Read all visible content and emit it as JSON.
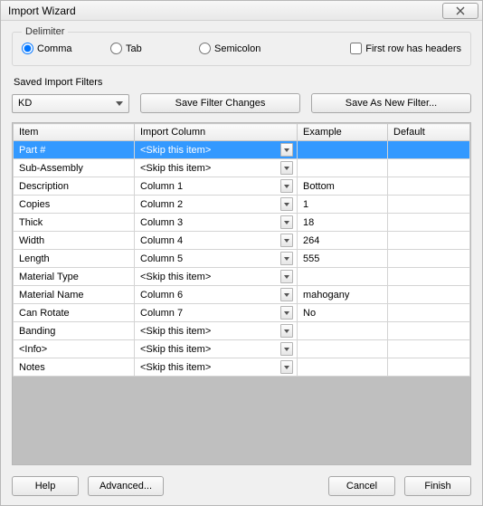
{
  "window": {
    "title": "Import Wizard"
  },
  "delimiter": {
    "legend": "Delimiter",
    "options": {
      "comma": "Comma",
      "tab": "Tab",
      "semicolon": "Semicolon"
    },
    "selected": "comma",
    "first_row_has_headers_label": "First row has headers",
    "first_row_has_headers": false
  },
  "saved_filters": {
    "label": "Saved Import Filters",
    "selected": "KD",
    "save_changes_label": "Save Filter Changes",
    "save_as_new_label": "Save As New Filter..."
  },
  "columns": {
    "item": "Item",
    "import_column": "Import Column",
    "example": "Example",
    "default": "Default"
  },
  "rows": [
    {
      "item": "Part #",
      "import_column": "<Skip this item>",
      "example": "",
      "default": "",
      "selected": true
    },
    {
      "item": "Sub-Assembly",
      "import_column": "<Skip this item>",
      "example": "",
      "default": ""
    },
    {
      "item": "Description",
      "import_column": "Column 1",
      "example": "Bottom",
      "default": ""
    },
    {
      "item": "Copies",
      "import_column": "Column 2",
      "example": "1",
      "default": ""
    },
    {
      "item": "Thick",
      "import_column": "Column 3",
      "example": "18",
      "default": ""
    },
    {
      "item": "Width",
      "import_column": "Column 4",
      "example": "264",
      "default": ""
    },
    {
      "item": "Length",
      "import_column": "Column 5",
      "example": "555",
      "default": ""
    },
    {
      "item": "Material Type",
      "import_column": "<Skip this item>",
      "example": "",
      "default": ""
    },
    {
      "item": "Material Name",
      "import_column": "Column 6",
      "example": "mahogany",
      "default": ""
    },
    {
      "item": "Can Rotate",
      "import_column": "Column 7",
      "example": "No",
      "default": ""
    },
    {
      "item": "Banding",
      "import_column": "<Skip this item>",
      "example": "",
      "default": ""
    },
    {
      "item": "<Info>",
      "import_column": "<Skip this item>",
      "example": "",
      "default": ""
    },
    {
      "item": "Notes",
      "import_column": "<Skip this item>",
      "example": "",
      "default": ""
    }
  ],
  "footer": {
    "help": "Help",
    "advanced": "Advanced...",
    "cancel": "Cancel",
    "finish": "Finish"
  }
}
